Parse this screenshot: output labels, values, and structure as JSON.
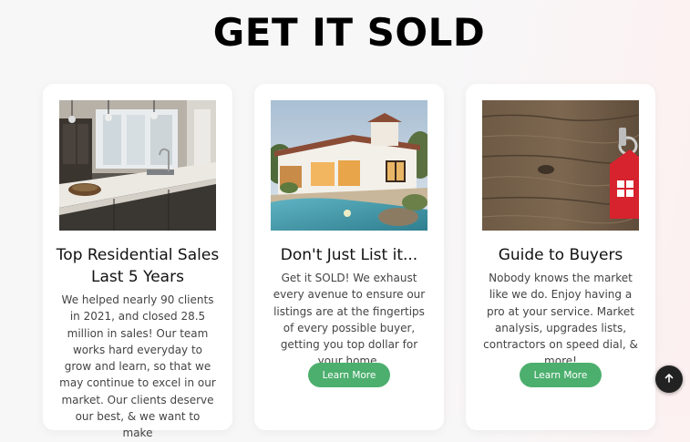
{
  "page": {
    "title": "GET IT SOLD"
  },
  "cards": [
    {
      "title": "Top Residential Sales Last 5 Years",
      "text": "We helped nearly 90 clients in 2021, and closed 28.5 million in sales! Our team works hard everyday to grow and learn, so that we may continue to excel in our market. Our clients deserve our best, & we want to make",
      "image": "kitchen-photo"
    },
    {
      "title": "Don't Just List it...",
      "text": "Get it SOLD! We exhaust every avenue to ensure our listings are at the fingertips of every possible buyer, getting you top dollar for your home.",
      "image": "house-pool-photo",
      "button_label": "Learn More"
    },
    {
      "title": "Guide to Buyers",
      "text": "Nobody knows the market like we do. Enjoy having a pro at your service. Market analysis, upgrades lists, contractors on speed dial, & more!",
      "image": "wood-keychain-photo",
      "button_label": "Learn More"
    }
  ],
  "scroll_top": {
    "icon": "arrow-up-icon"
  },
  "colors": {
    "button": "#4caf6e",
    "card_background": "#ffffff",
    "page_background": "#f7f7f8"
  }
}
